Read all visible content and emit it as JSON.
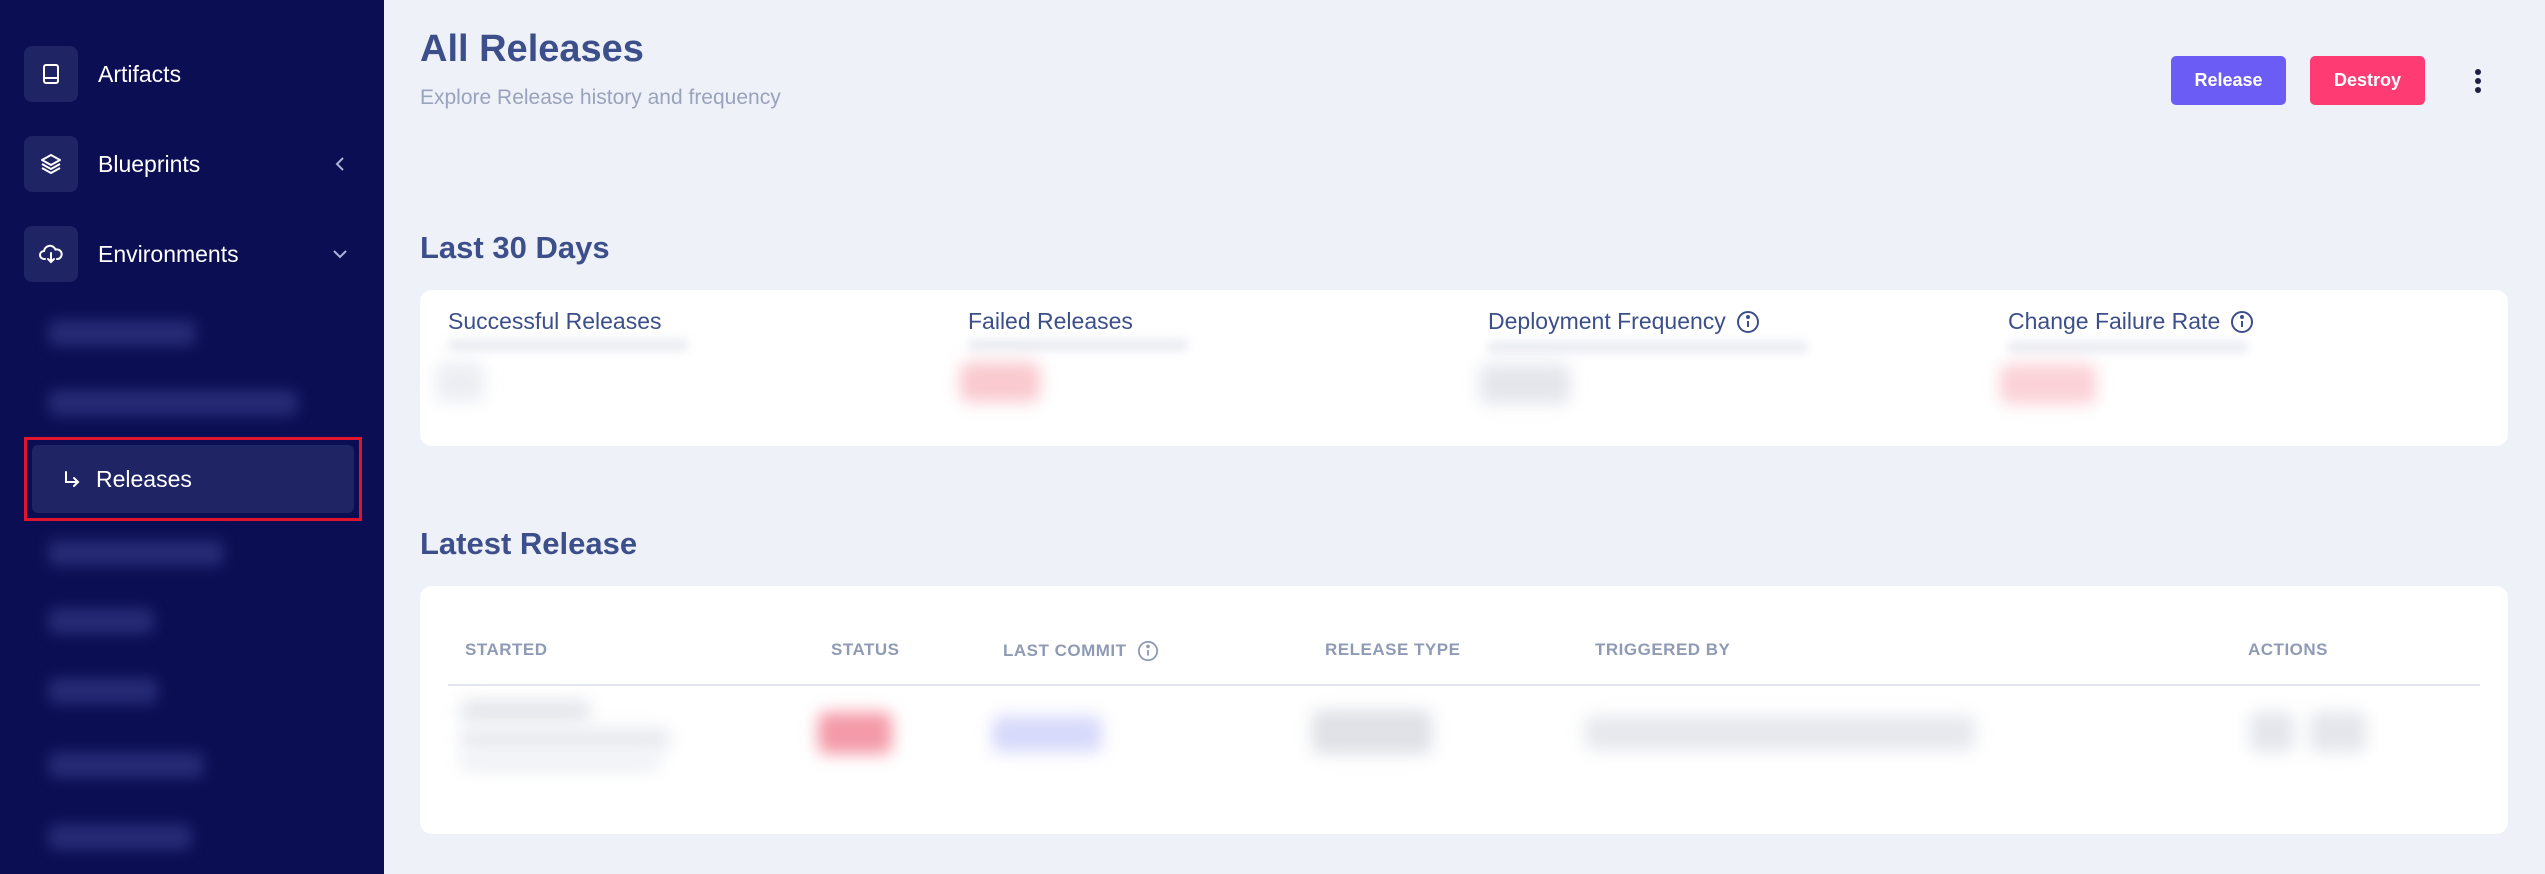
{
  "sidebar": {
    "items": [
      {
        "label": "Artifacts",
        "icon": "book-icon"
      },
      {
        "label": "Blueprints",
        "icon": "layers-icon",
        "chevron": "chevron-left-icon"
      },
      {
        "label": "Environments",
        "icon": "cloud-download-icon",
        "chevron": "chevron-down-icon"
      }
    ],
    "active_subitem": {
      "label": "Releases",
      "icon": "return-arrow-icon"
    }
  },
  "header": {
    "title": "All Releases",
    "subtitle": "Explore Release history and frequency",
    "release_button": "Release",
    "destroy_button": "Destroy"
  },
  "stats_section": {
    "title": "Last 30 Days",
    "stats": [
      {
        "label": "Successful Releases"
      },
      {
        "label": "Failed Releases"
      },
      {
        "label": "Deployment Frequency"
      },
      {
        "label": "Change Failure Rate"
      }
    ]
  },
  "latest_section": {
    "title": "Latest Release",
    "columns": [
      "STARTED",
      "STATUS",
      "LAST COMMIT",
      "RELEASE TYPE",
      "TRIGGERED BY",
      "ACTIONS"
    ]
  },
  "colors": {
    "sidebar_bg": "#0b0e53",
    "accent_release": "#6a5cf5",
    "accent_destroy": "#ff3b73",
    "heading": "#3c4f8a",
    "active_outline": "#e0142c"
  }
}
